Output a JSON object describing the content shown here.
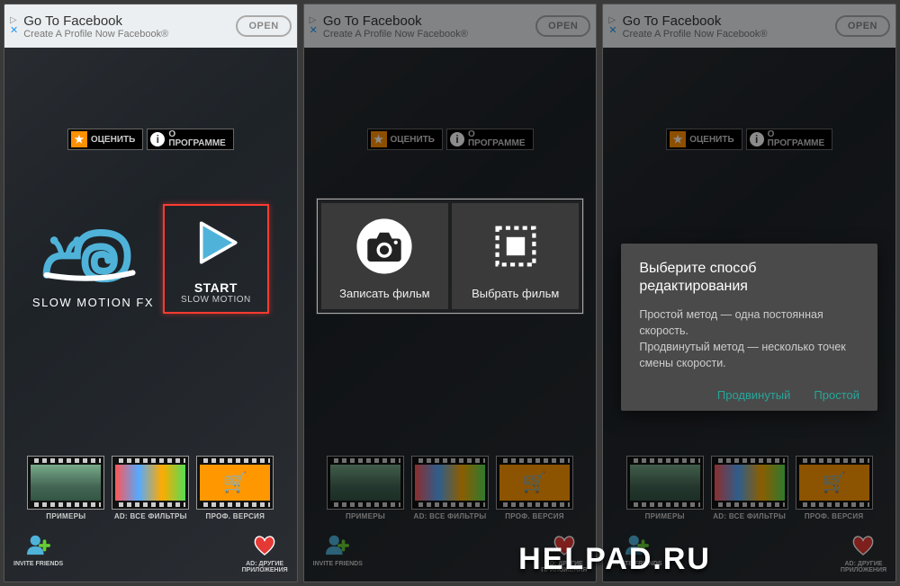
{
  "ad": {
    "title": "Go To Facebook",
    "subtitle": "Create A Profile Now Facebook®",
    "button": "OPEN"
  },
  "topbuttons": {
    "rate": "ОЦЕНИТЬ",
    "about_l1": "О",
    "about_l2": "ПРОГРАММЕ"
  },
  "logo": {
    "title": "SLOW MOTION FX"
  },
  "start": {
    "label": "START",
    "sub": "SLOW MOTION"
  },
  "films": {
    "examples": "ПРИМЕРЫ",
    "adfilm": "AD: ВСЕ ФИЛЬТРЫ",
    "pro": "ПРОФ. ВЕРСИЯ"
  },
  "bottom": {
    "invite": "INVITE FRIENDS",
    "otherapps_l1": "AD: ДРУГИЕ",
    "otherapps_l2": "ПРИЛОЖЕНИЯ"
  },
  "choose": {
    "record": "Записать фильм",
    "pick": "Выбрать фильм"
  },
  "dialog": {
    "title": "Выберите способ редактирования",
    "body1": "Простой метод — одна постоянная скорость.",
    "body2": "Продвинутый метод — несколько точек смены скорости.",
    "advanced": "Продвинутый",
    "simple": "Простой"
  },
  "watermark": "HELPAD.RU"
}
